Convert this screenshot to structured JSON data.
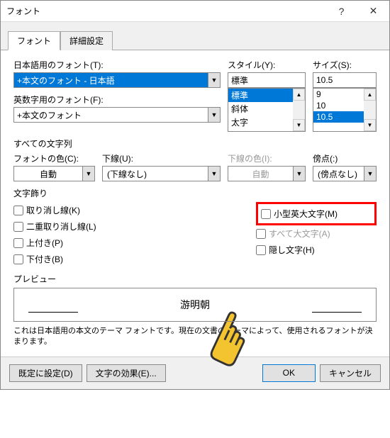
{
  "title": "フォント",
  "tabs": {
    "font": "フォント",
    "advanced": "詳細設定"
  },
  "labels": {
    "jp_font": "日本語用のフォント(T):",
    "en_font": "英数字用のフォント(F):",
    "style": "スタイル(Y):",
    "size": "サイズ(S):",
    "all_text": "すべての文字列",
    "font_color": "フォントの色(C):",
    "underline": "下線(U):",
    "underline_color": "下線の色(I):",
    "emphasis": "傍点(:)",
    "decoration": "文字飾り"
  },
  "values": {
    "jp_font": "+本文のフォント - 日本語",
    "en_font": "+本文のフォント",
    "style": "標準",
    "size": "10.5",
    "font_color": "自動",
    "underline": "(下線なし)",
    "underline_color": "自動",
    "emphasis": "(傍点なし)"
  },
  "style_options": [
    "標準",
    "斜体",
    "太字"
  ],
  "size_options": [
    "9",
    "10",
    "10.5"
  ],
  "checks": {
    "strike": "取り消し線(K)",
    "dstrike": "二重取り消し線(L)",
    "superscript": "上付き(P)",
    "subscript": "下付き(B)",
    "smallcaps": "小型英大文字(M)",
    "allcaps": "すべて大文字(A)",
    "hidden": "隠し文字(H)"
  },
  "preview": {
    "label": "プレビュー",
    "text": "游明朝"
  },
  "desc": "これは日本語用の本文のテーマ フォントです。現在の文書のテーマによって、使用されるフォントが決まります。",
  "footer": {
    "default": "既定に設定(D)",
    "effects": "文字の効果(E)...",
    "ok": "OK",
    "cancel": "キャンセル"
  }
}
